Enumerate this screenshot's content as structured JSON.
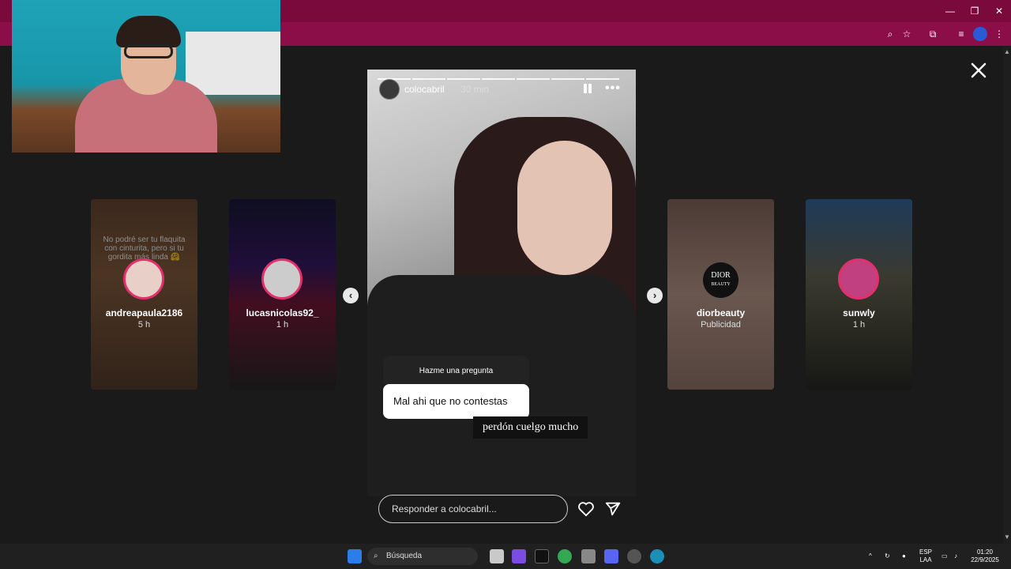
{
  "story": {
    "username": "colocabril",
    "time": "30 min",
    "question_header": "Hazme una pregunta",
    "question_text": "Mal ahi que no contestas",
    "reply_text": "perdón cuelgo mucho",
    "reply_placeholder": "Responder a colocabril..."
  },
  "side_stories": [
    {
      "username": "andreapaula2186",
      "sub": "5 h",
      "caption": "No podré ser tu flaquita con cinturita, pero si tu gordita más linda 🤗"
    },
    {
      "username": "lucasnicolas92_",
      "sub": "1 h"
    },
    {
      "username": "diorbeauty",
      "sub": "Publicidad",
      "logo_text_1": "DIOR",
      "logo_text_2": "BEAUTY"
    },
    {
      "username": "sunwly",
      "sub": "1 h"
    }
  ],
  "taskbar": {
    "search_label": "Búsqueda",
    "lang_1": "ESP",
    "lang_2": "LAA",
    "time": "01:20",
    "date": "22/9/2025"
  },
  "icons": {
    "close": "close-icon",
    "prev": "chevron-left-icon",
    "next": "chevron-right-icon",
    "pause": "pause-icon",
    "more": "more-icon",
    "heart": "heart-icon",
    "send": "send-icon"
  },
  "colors": {
    "browser_titlebar": "#7a0a3c",
    "browser_toolbar": "#8c0e48",
    "background": "#1a1a1a",
    "story_ring": "#e1306c"
  }
}
